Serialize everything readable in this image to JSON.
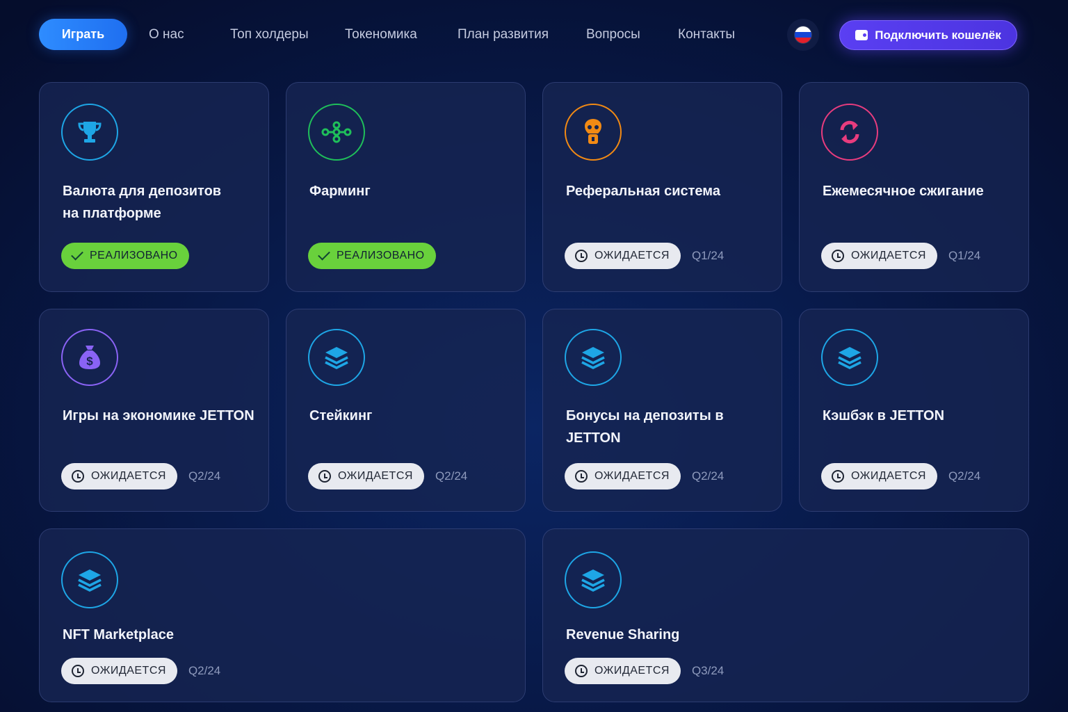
{
  "nav": {
    "play_label": "Играть",
    "links": [
      "О нас",
      "Топ холдеры",
      "Токеномика",
      "План развития",
      "Вопросы",
      "Контакты"
    ],
    "wallet_label": "Подключить кошелёк"
  },
  "colors": {
    "accent_blue": "#2e8cff",
    "accent_purple": "#5a3ff2",
    "done_green": "#69d13c",
    "icon_blue": "#1ea6e6",
    "icon_green": "#1fbf5a",
    "icon_orange": "#f28a14",
    "icon_pink": "#e83c7e",
    "icon_purple": "#8a63f5"
  },
  "cards": [
    {
      "title": "Валюта для депозитов\nна платформе",
      "icon": "trophy-icon",
      "status": "РЕАЛИЗОВАНО",
      "done": true,
      "quarter": ""
    },
    {
      "title": "Фарминг",
      "icon": "network-icon",
      "status": "РЕАЛИЗОВАНО",
      "done": true,
      "quarter": ""
    },
    {
      "title": "Реферальная система",
      "icon": "referral-icon",
      "status": "ОЖИДАЕТСЯ",
      "done": false,
      "quarter": "Q1/24"
    },
    {
      "title": "Ежемесячное сжигание",
      "icon": "refresh-icon",
      "status": "ОЖИДАЕТСЯ",
      "done": false,
      "quarter": "Q1/24"
    },
    {
      "title": "Игры на экономике JETTON",
      "icon": "money-bag-icon",
      "status": "ОЖИДАЕТСЯ",
      "done": false,
      "quarter": "Q2/24"
    },
    {
      "title": "Стейкинг",
      "icon": "layers-icon",
      "status": "ОЖИДАЕТСЯ",
      "done": false,
      "quarter": "Q2/24"
    },
    {
      "title": "Бонусы на депозиты в\nJETTON",
      "icon": "layers-icon",
      "status": "ОЖИДАЕТСЯ",
      "done": false,
      "quarter": "Q2/24"
    },
    {
      "title": "Кэшбэк в JETTON",
      "icon": "layers-icon",
      "status": "ОЖИДАЕТСЯ",
      "done": false,
      "quarter": "Q2/24"
    },
    {
      "title": "NFT Marketplace",
      "icon": "layers-icon",
      "status": "ОЖИДАЕТСЯ",
      "done": false,
      "quarter": "Q2/24"
    },
    {
      "title": "Revenue Sharing",
      "icon": "layers-icon",
      "status": "ОЖИДАЕТСЯ",
      "done": false,
      "quarter": "Q3/24"
    }
  ]
}
